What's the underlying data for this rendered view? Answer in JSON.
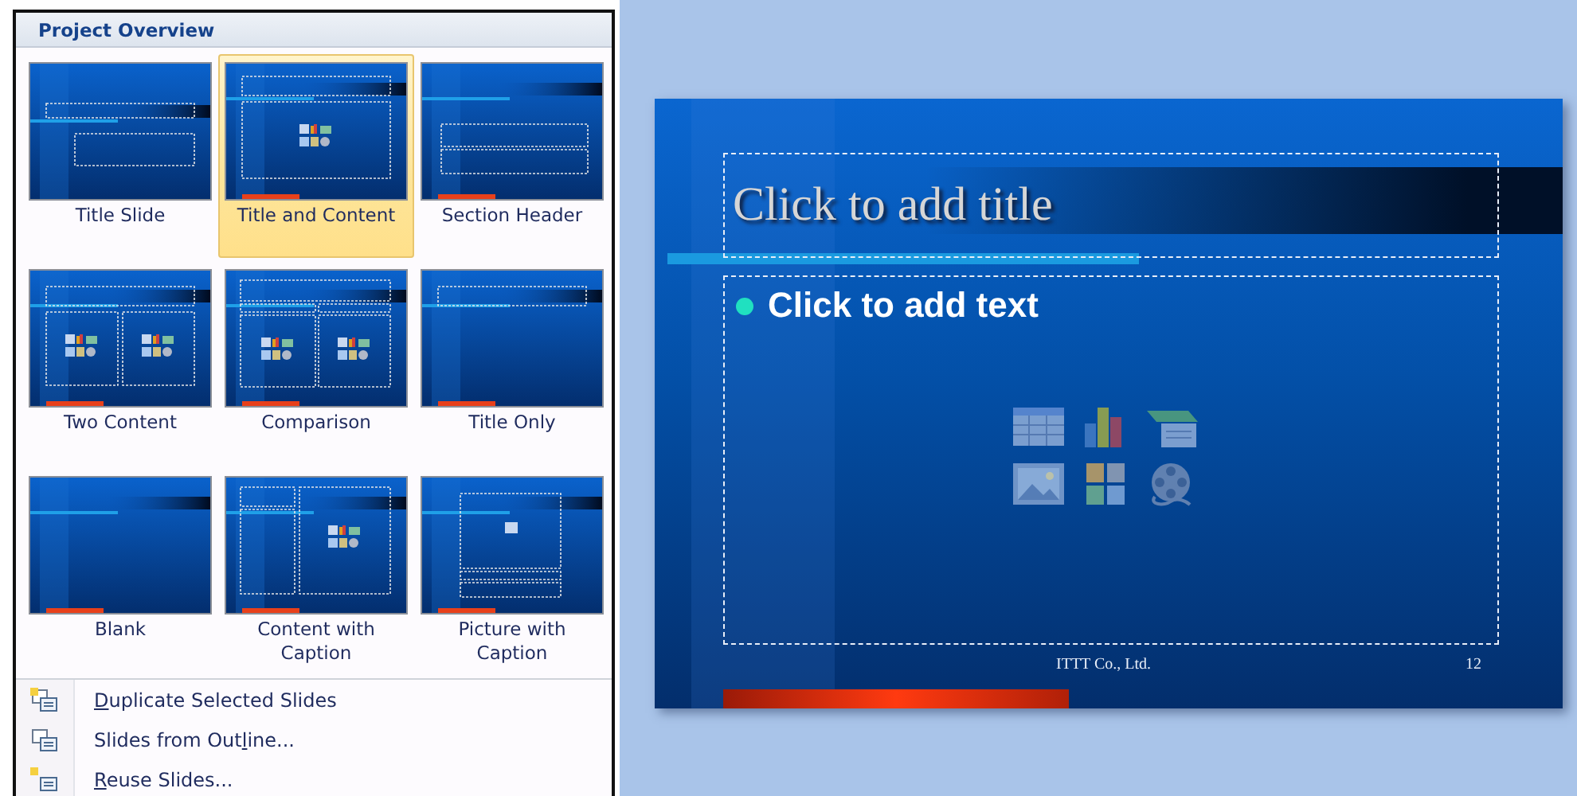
{
  "panel": {
    "title": "Project Overview",
    "layouts": [
      {
        "label": "Title Slide",
        "kind": "title",
        "selected": false
      },
      {
        "label": "Title and Content",
        "kind": "title-content",
        "selected": true
      },
      {
        "label": "Section Header",
        "kind": "section",
        "selected": false
      },
      {
        "label": "Two Content",
        "kind": "two-content",
        "selected": false
      },
      {
        "label": "Comparison",
        "kind": "comparison",
        "selected": false
      },
      {
        "label": "Title Only",
        "kind": "title-only",
        "selected": false
      },
      {
        "label": "Blank",
        "kind": "blank",
        "selected": false
      },
      {
        "label": "Content with Caption",
        "kind": "content-caption",
        "selected": false
      },
      {
        "label": "Picture with Caption",
        "kind": "picture-caption",
        "selected": false
      }
    ],
    "menu": [
      {
        "label_parts": [
          {
            "text": "D",
            "underlined": true
          },
          {
            "text": "uplicate Selected Slides",
            "underlined": false
          }
        ],
        "kind": "duplicate"
      },
      {
        "label_parts": [
          {
            "text": "Slides from Out",
            "underlined": false
          },
          {
            "text": "l",
            "underlined": true
          },
          {
            "text": "ine...",
            "underlined": false
          }
        ],
        "kind": "outline"
      },
      {
        "label_parts": [
          {
            "text": "R",
            "underlined": true
          },
          {
            "text": "euse Slides...",
            "underlined": false
          }
        ],
        "kind": "reuse"
      }
    ]
  },
  "slide": {
    "title_placeholder": "Click to add title",
    "body_placeholder": "Click to add text",
    "footer": "ITTT Co., Ltd.",
    "slide_number": "12"
  }
}
